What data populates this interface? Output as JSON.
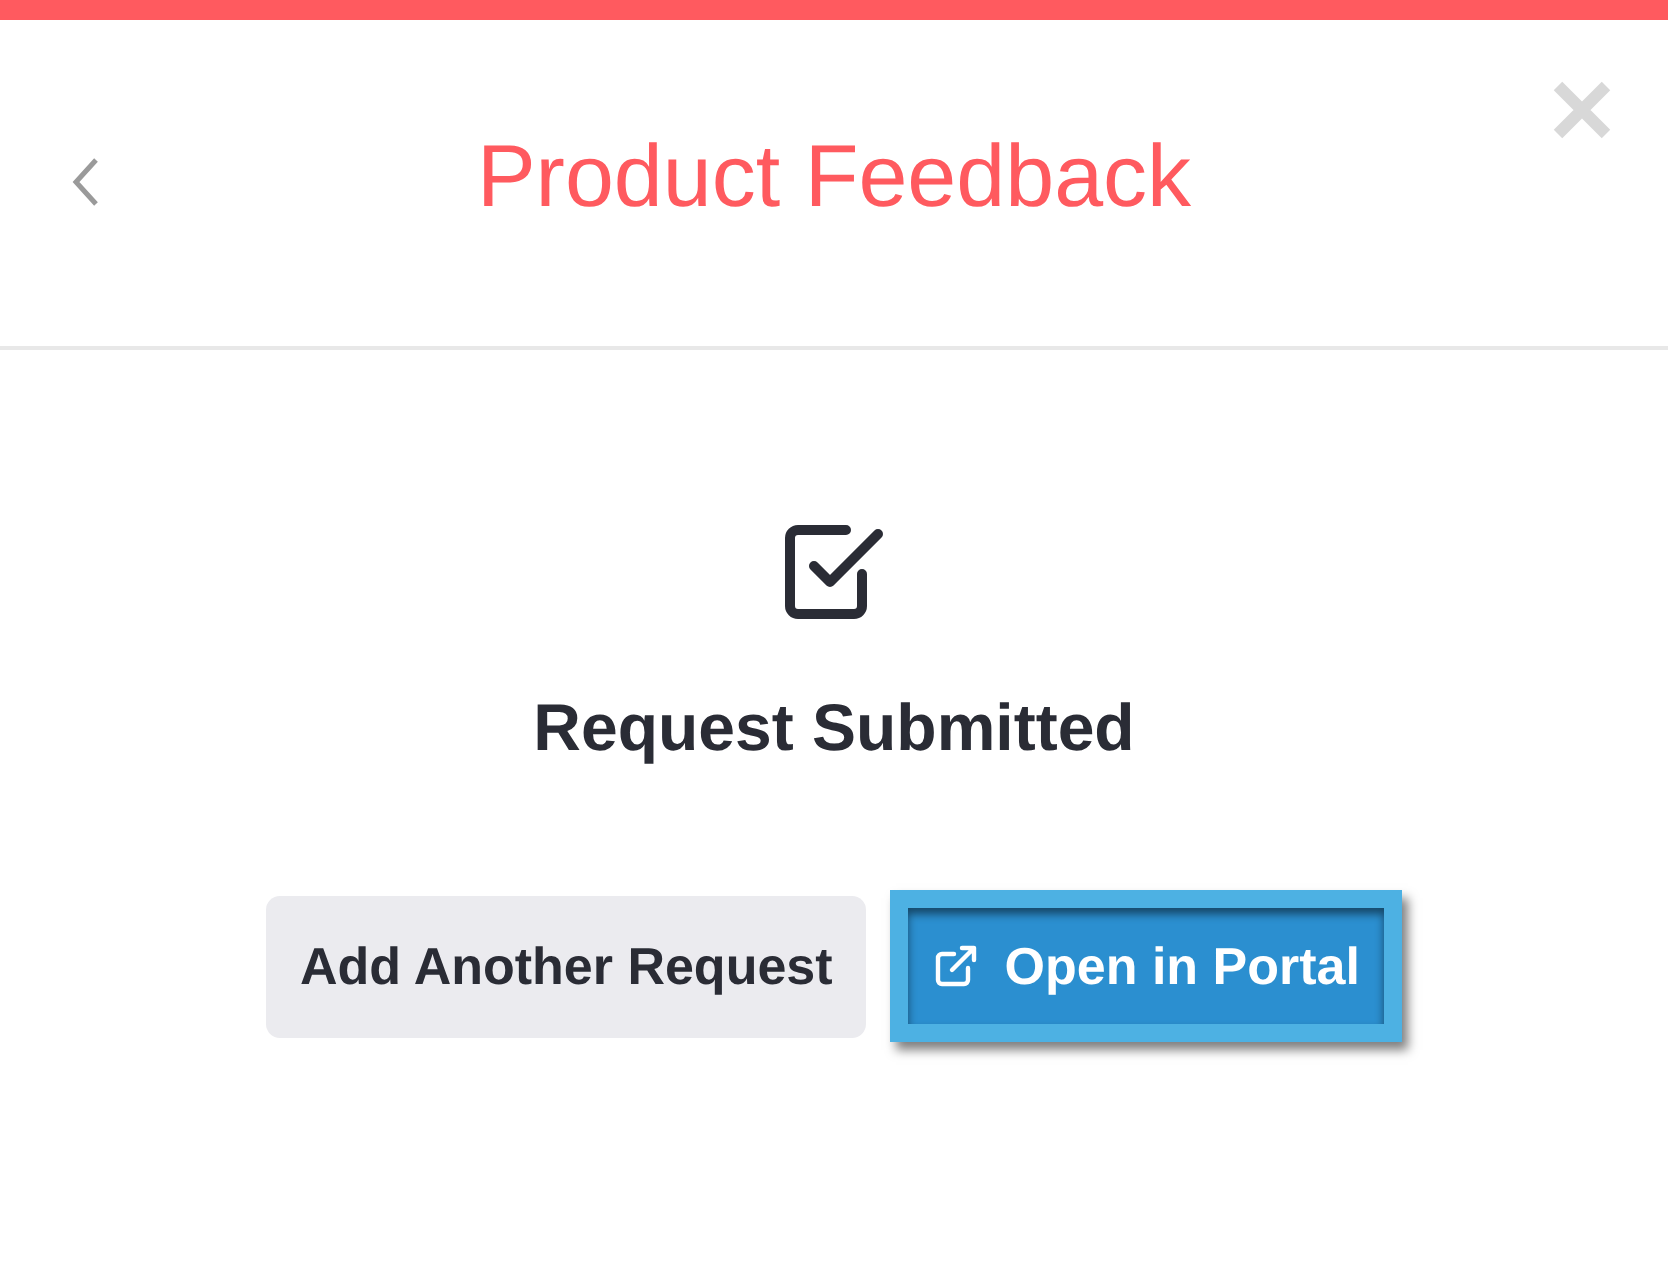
{
  "header": {
    "title": "Product Feedback"
  },
  "status": {
    "heading": "Request Submitted"
  },
  "buttons": [
    {
      "label": "Add Another Request",
      "kind": "secondary",
      "focused": false
    },
    {
      "label": "Open in Portal",
      "kind": "primary",
      "focused": true
    }
  ]
}
